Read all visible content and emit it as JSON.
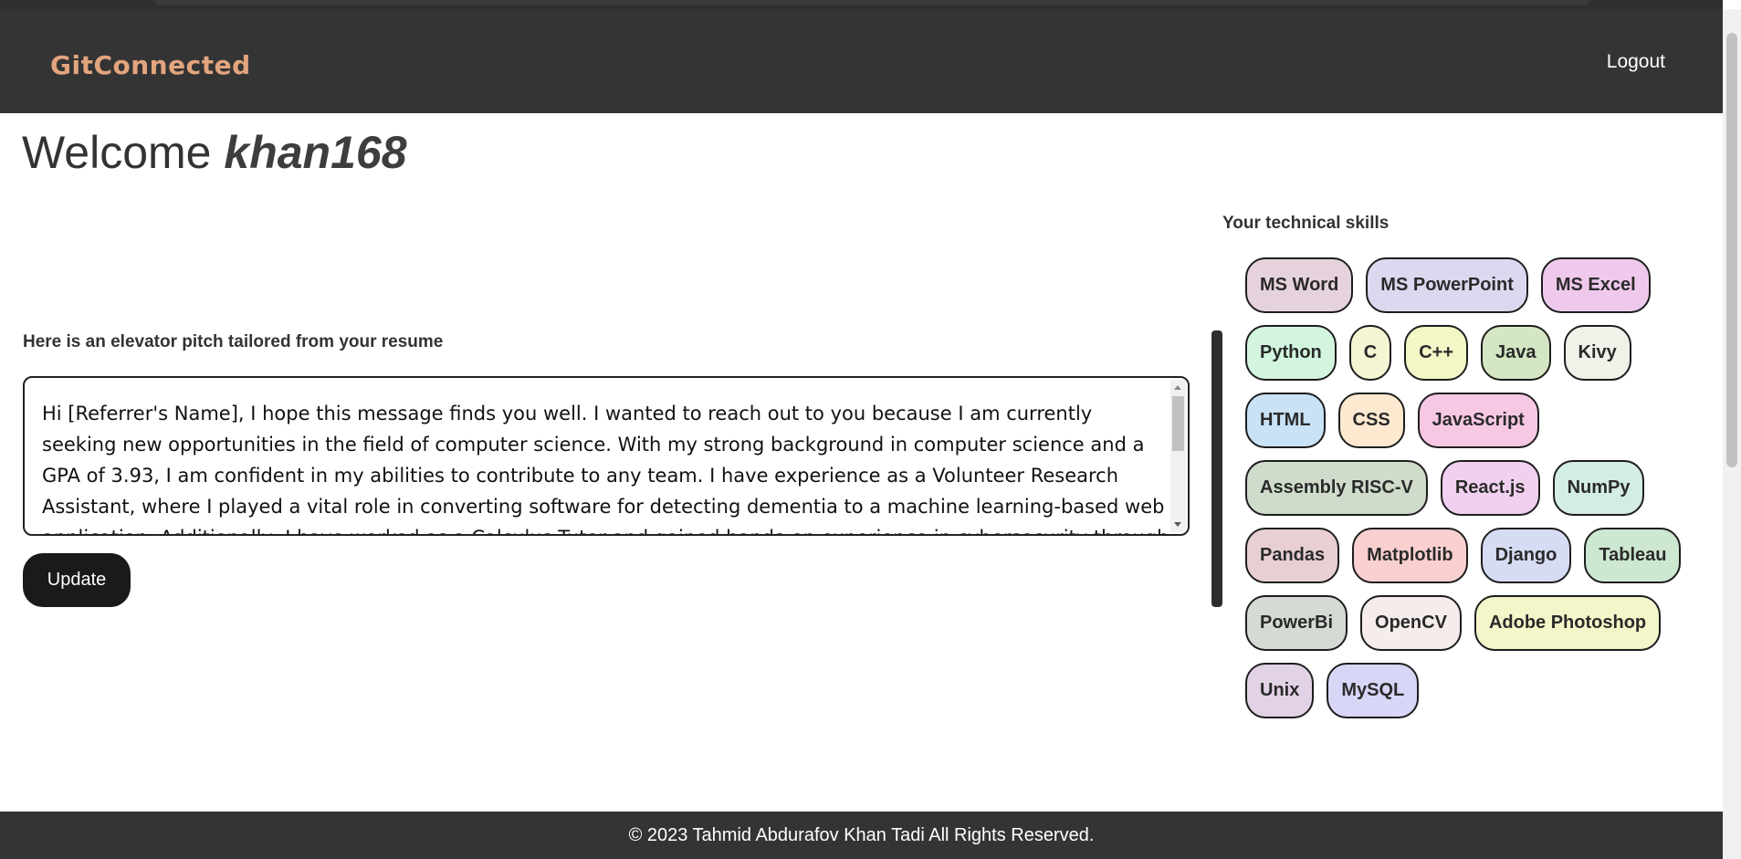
{
  "header": {
    "logo_text": "GitConnected",
    "logout_label": "Logout"
  },
  "welcome": {
    "prefix": "Welcome",
    "username": "khan168"
  },
  "pitch": {
    "heading": "Here is an elevator pitch tailored from your resume",
    "text": "Hi [Referrer's Name], I hope this message finds you well. I wanted to reach out to you because I am currently seeking new opportunities in the field of computer science. With my strong background in computer science and a GPA of 3.93, I am confident in my abilities to contribute to any team. I have experience as a Volunteer Research Assistant, where I played a vital role in converting software for detecting dementia to a machine learning-based web application. Additionally, I have worked as a Calculus Tutor and gained hands-on experience in cybersecurity through the Goldman",
    "update_label": "Update"
  },
  "skills": {
    "heading": "Your technical skills",
    "rows": [
      [
        {
          "label": "MS Word",
          "color": "#e6d2dc"
        },
        {
          "label": "MS PowerPoint",
          "color": "#ddd8ef"
        },
        {
          "label": "MS Excel",
          "color": "#efc9ec"
        }
      ],
      [
        {
          "label": "Python",
          "color": "#d3f5df"
        },
        {
          "label": "C",
          "color": "#f5f4d3"
        },
        {
          "label": "C++",
          "color": "#f3f7c6"
        },
        {
          "label": "Java",
          "color": "#d4e6c4"
        },
        {
          "label": "Kivy",
          "color": "#f1f1ea"
        }
      ],
      [
        {
          "label": "HTML",
          "color": "#c9e2f5"
        },
        {
          "label": "CSS",
          "color": "#fde9d0"
        },
        {
          "label": "JavaScript",
          "color": "#f7c8e4"
        }
      ],
      [
        {
          "label": "Assembly RISC-V",
          "color": "#cfdccc"
        },
        {
          "label": "React.js",
          "color": "#f0d0ee"
        },
        {
          "label": "NumPy",
          "color": "#d3ece4"
        }
      ],
      [
        {
          "label": "Pandas",
          "color": "#e7cfd3"
        },
        {
          "label": "Matplotlib",
          "color": "#f9d0cf"
        },
        {
          "label": "Django",
          "color": "#d6dcf3"
        },
        {
          "label": "Tableau",
          "color": "#cde7d0"
        }
      ],
      [
        {
          "label": "PowerBi",
          "color": "#d5dbd4"
        },
        {
          "label": "OpenCV",
          "color": "#f7ecec"
        },
        {
          "label": "Adobe Photoshop",
          "color": "#f4f6c9"
        }
      ],
      [
        {
          "label": "Unix",
          "color": "#e2d2e6"
        },
        {
          "label": "MySQL",
          "color": "#d8d6f7"
        }
      ]
    ]
  },
  "footer": {
    "text": "© 2023 Tahmid Abdurafov Khan Tadi All Rights Reserved."
  }
}
